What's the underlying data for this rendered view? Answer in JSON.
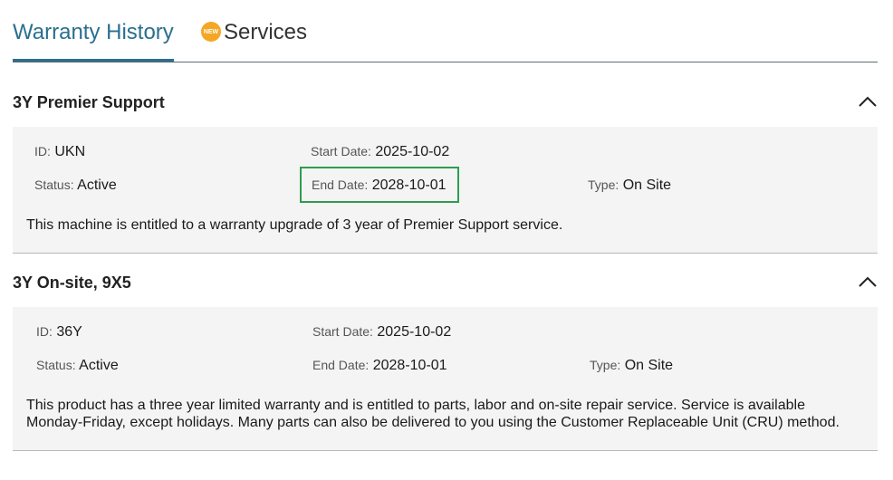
{
  "tabs": {
    "history_label": "Warranty History",
    "services_label": "Services",
    "new_badge": "NEW"
  },
  "warranties": [
    {
      "title": "3Y Premier Support",
      "id_label": "ID:",
      "id": "UKN",
      "start_label": "Start Date:",
      "start": "2025-10-02",
      "status_label": "Status:",
      "status": "Active",
      "end_label": "End Date:",
      "end": "2028-10-01",
      "type_label": "Type:",
      "type": "On Site",
      "description": "This machine is entitled to a warranty upgrade of 3 year of Premier Support service."
    },
    {
      "title": "3Y On-site, 9X5",
      "id_label": "ID:",
      "id": "36Y",
      "start_label": "Start Date:",
      "start": "2025-10-02",
      "status_label": "Status:",
      "status": "Active",
      "end_label": "End Date:",
      "end": "2028-10-01",
      "type_label": "Type:",
      "type": "On Site",
      "description": "This product has a three year limited warranty and is entitled to parts, labor and on-site repair service. Service is available Monday-Friday, except holidays. Many parts can also be delivered to you using the Customer Replaceable Unit (CRU) method."
    }
  ],
  "colors": {
    "accent": "#2a6f8f",
    "highlight": "#2e9e4f",
    "badge": "#f5a623"
  }
}
